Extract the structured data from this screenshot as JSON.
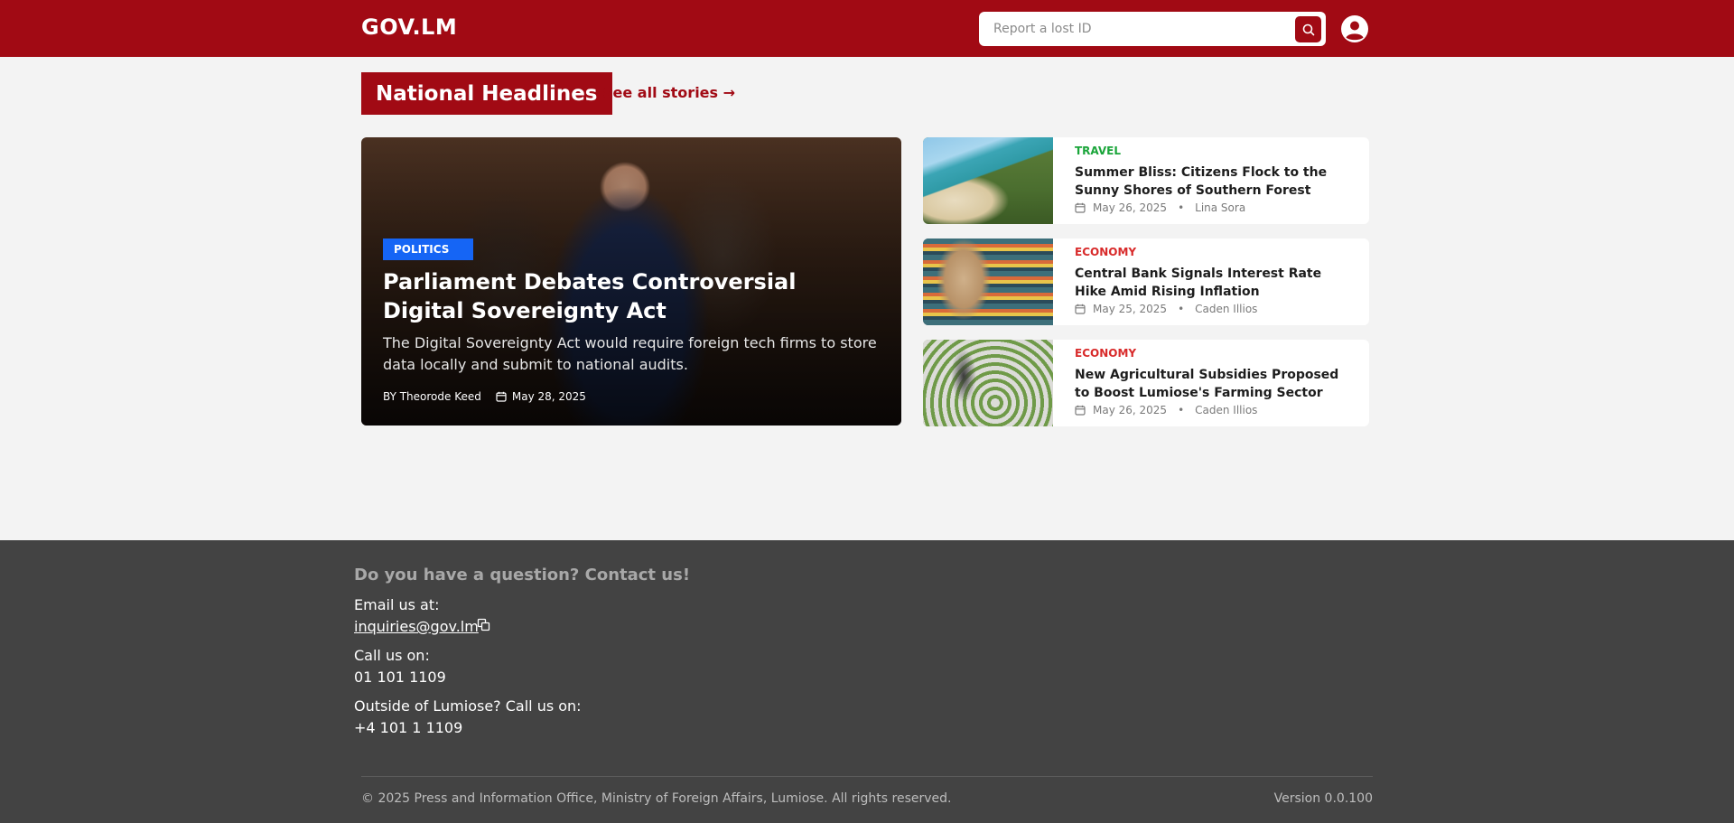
{
  "header": {
    "logo": "GOV.LM",
    "search_placeholder": "Report a lost ID"
  },
  "section": {
    "title": "National Headlines",
    "see_all": "See all stories →"
  },
  "featured": {
    "category": "POLITICS",
    "title": "Parliament Debates Controversial Digital Sovereignty Act",
    "description": "The Digital Sovereignty Act would require foreign tech firms to store data locally and submit to national audits.",
    "byline": "BY Theorode Keed",
    "date": "May 28, 2025"
  },
  "stories": [
    {
      "category": "TRAVEL",
      "category_color": "#1aa53a",
      "title": "Summer Bliss: Citizens Flock to the Sunny Shores of Southern Forest",
      "date": "May 26, 2025",
      "author": "Lina Sora"
    },
    {
      "category": "ECONOMY",
      "category_color": "#d82a2a",
      "title": "Central Bank Signals Interest Rate Hike Amid Rising Inflation",
      "date": "May 25, 2025",
      "author": "Caden Illios"
    },
    {
      "category": "ECONOMY",
      "category_color": "#d82a2a",
      "title": "New Agricultural Subsidies Proposed to Boost Lumiose's Farming Sector",
      "date": "May 26, 2025",
      "author": "Caden Illios"
    }
  ],
  "footer": {
    "question": "Do you have a question? Contact us!",
    "email_label": "Email us at:",
    "email": "inquiries@gov.lm",
    "call_label": "Call us on:",
    "phone": "01 101 1109",
    "outside_label": "Outside of Lumiose? Call us on:",
    "intl_phone": "+4 101 1 1109",
    "copyright": "© 2025 Press and Information Office, Ministry of Foreign Affairs, Lumiose. All rights reserved.",
    "version": "Version 0.0.100"
  },
  "colors": {
    "brand": "#a10a14",
    "tag_blue": "#1565f5",
    "footer_bg": "#434343"
  }
}
